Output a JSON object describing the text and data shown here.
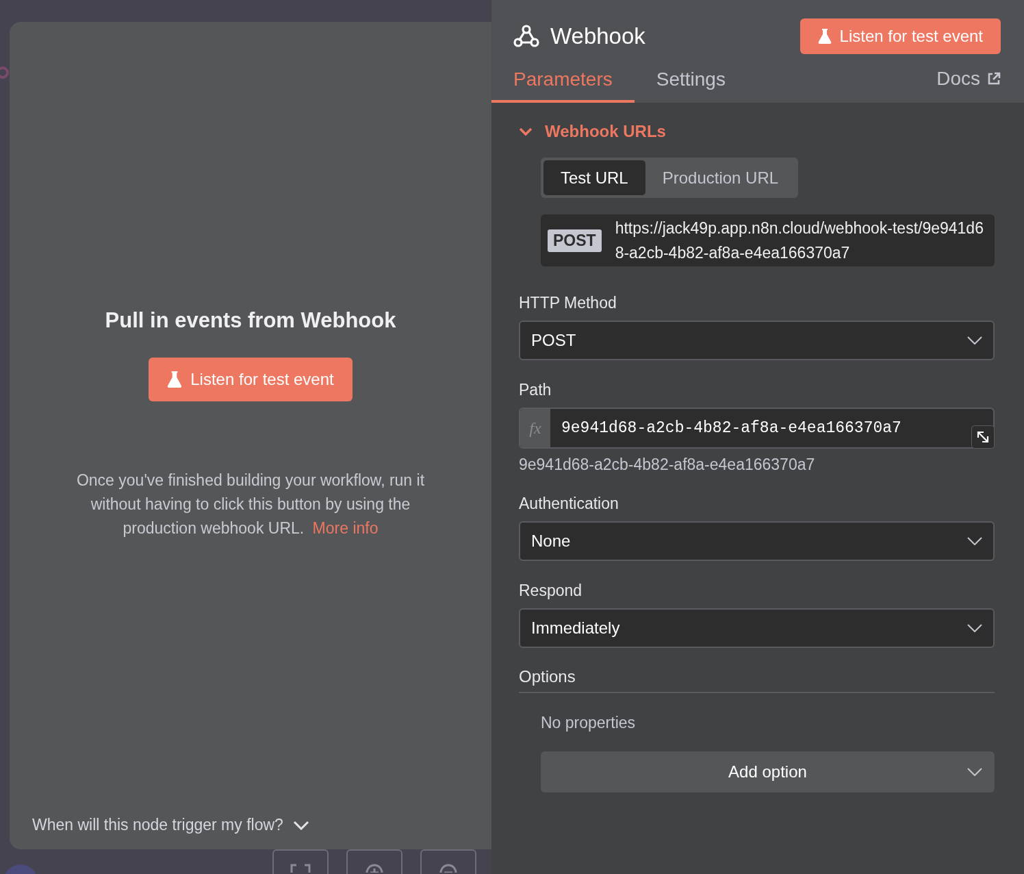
{
  "canvas": {
    "controls": [
      {
        "kind": "fit"
      },
      {
        "kind": "zoom_in"
      },
      {
        "kind": "zoom_out"
      }
    ]
  },
  "trigger_panel": {
    "title": "Pull in events from Webhook",
    "button": "Listen for test event",
    "description": "Once you've finished building your workflow, run it without having to click this button by using the production webhook URL.",
    "link": "More info",
    "faq": "When will this node trigger my flow?"
  },
  "node": {
    "title": "Webhook",
    "button": "Listen for test event"
  },
  "tabs": [
    {
      "label": "Parameters",
      "selected": true
    },
    {
      "label": "Settings",
      "selected": false
    }
  ],
  "docs_link": "Docs",
  "webhook_urls": {
    "title": "Webhook URLs",
    "expanded": true,
    "toggle": [
      {
        "label": "Test URL",
        "selected": true
      },
      {
        "label": "Production URL",
        "selected": false
      }
    ],
    "method": "POST",
    "url": "https://jack49p.app.n8n.cloud/webhook-test/9e941d68-a2cb-4b82-af8a-e4ea166370a7"
  },
  "fields": [
    {
      "kind": "select",
      "label": "HTTP Method",
      "value": "POST"
    },
    {
      "kind": "expression",
      "label": "Path",
      "prefix": "fx",
      "value": "9e941d68-a2cb-4b82-af8a-e4ea166370a7",
      "hint": "9e941d68-a2cb-4b82-af8a-e4ea166370a7"
    },
    {
      "kind": "select",
      "label": "Authentication",
      "value": "None"
    },
    {
      "kind": "select",
      "label": "Respond",
      "value": "Immediately"
    }
  ],
  "options": {
    "title": "Options",
    "empty": "No properties",
    "button": "Add option"
  }
}
